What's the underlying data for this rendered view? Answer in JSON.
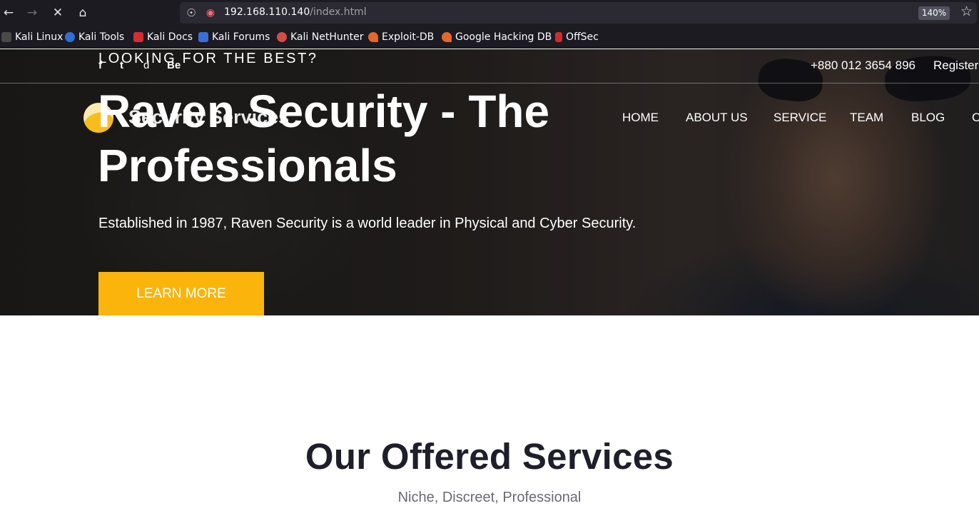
{
  "browser": {
    "url_host": "192.168.110.140",
    "url_path": "/index.html",
    "zoom": "140%",
    "bookmarks": [
      {
        "label": "Kali Linux",
        "color": "#4a4a4a"
      },
      {
        "label": "Kali Tools",
        "color": "#2f6fd6"
      },
      {
        "label": "Kali Docs",
        "color": "#d32f2f"
      },
      {
        "label": "Kali Forums",
        "color": "#3a6fd8"
      },
      {
        "label": "Kali NetHunter",
        "color": "#d84a4a"
      },
      {
        "label": "Exploit-DB",
        "color": "#e5672a"
      },
      {
        "label": "Google Hacking DB",
        "color": "#e5672a"
      },
      {
        "label": "OffSec",
        "color": "#d22b2b"
      }
    ]
  },
  "topbar": {
    "tagline": "LOOKING FOR THE BEST?",
    "social": [
      "f",
      "t",
      "d",
      "Be"
    ],
    "phone": "+880 012 3654 896",
    "register": "Register"
  },
  "header": {
    "logo_text": "Security Services",
    "menu": [
      "HOME",
      "ABOUT US",
      "SERVICE",
      "TEAM",
      "BLOG",
      "C"
    ]
  },
  "hero": {
    "title": "Raven Security - The Professionals",
    "subtitle": "Established in 1987, Raven Security is a world leader in Physical and Cyber Security.",
    "cta": "LEARN MORE"
  },
  "services": {
    "title": "Our Offered Services",
    "subtitle": "Niche, Discreet, Professional"
  },
  "colors": {
    "accent": "#fbb40b",
    "heading": "#1f1f2b"
  }
}
